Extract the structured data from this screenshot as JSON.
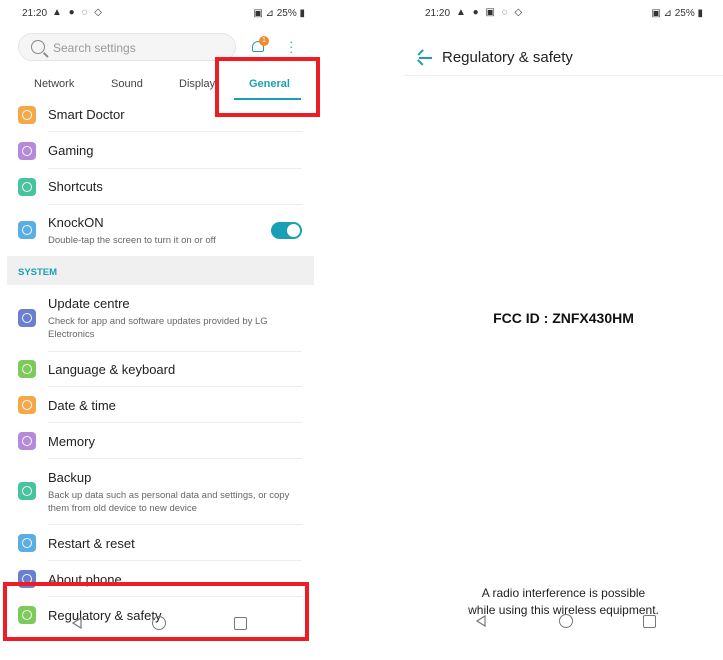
{
  "left": {
    "status": {
      "time": "21:20",
      "battery": "25%"
    },
    "search": {
      "placeholder": "Search settings"
    },
    "notifications": {
      "badge": "1"
    },
    "tabs": [
      {
        "label": "Network"
      },
      {
        "label": "Sound"
      },
      {
        "label": "Display"
      },
      {
        "label": "General"
      }
    ],
    "items_top": [
      {
        "title": "Smart Doctor",
        "color": "#f3a84a"
      },
      {
        "title": "Gaming",
        "color": "#b48ad9"
      },
      {
        "title": "Shortcuts",
        "color": "#47c49d"
      },
      {
        "title": "KnockON",
        "sub": "Double-tap the screen to turn it on or off",
        "color": "#5aaee3",
        "toggle_on": true
      }
    ],
    "section": {
      "label": "SYSTEM"
    },
    "items_system": [
      {
        "title": "Update centre",
        "sub": "Check for app and software updates provided by LG Electronics",
        "color": "#6a7fd0"
      },
      {
        "title": "Language & keyboard",
        "color": "#7ccb5a"
      },
      {
        "title": "Date & time",
        "color": "#f3a84a"
      },
      {
        "title": "Memory",
        "color": "#b48ad9"
      },
      {
        "title": "Backup",
        "sub": "Back up data such as personal data and settings, or copy them from old device to new device",
        "color": "#47c49d"
      },
      {
        "title": "Restart & reset",
        "color": "#5aaee3"
      },
      {
        "title": "About phone",
        "color": "#6a7fd0"
      },
      {
        "title": "Regulatory & safety",
        "color": "#7ccb5a"
      }
    ]
  },
  "right": {
    "status": {
      "time": "21:20",
      "battery": "25%"
    },
    "header": {
      "title": "Regulatory & safety"
    },
    "fcc": "FCC ID : ZNFX430HM",
    "warning_line1": "A radio interference is possible",
    "warning_line2": "while using this wireless equipment."
  },
  "colors": {
    "accent": "#1aa0b5",
    "highlight": "#ee1c25"
  }
}
